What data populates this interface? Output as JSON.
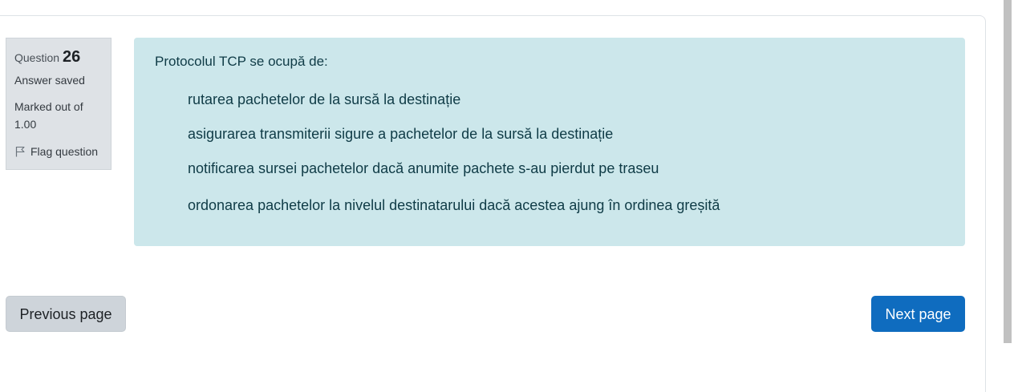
{
  "question_info": {
    "label": "Question",
    "number": "26",
    "state": "Answer saved",
    "grade": "Marked out of 1.00",
    "flag_label": "Flag question"
  },
  "question": {
    "text": "Protocolul TCP se ocupă de:",
    "answers": [
      "rutarea pachetelor de la sursă la destinație",
      "asigurarea transmiterii sigure a pachetelor de la sursă la destinație",
      "notificarea sursei pachetelor dacă anumite pachete s-au pierdut pe traseu",
      "ordonarea pachetelor la nivelul destinatarului dacă acestea ajung în ordinea greșită"
    ]
  },
  "navigation": {
    "previous_label": "Previous page",
    "next_label": "Next page"
  },
  "colors": {
    "content_background": "#cce7eb",
    "next_button": "#0f6cbf",
    "previous_button": "#ced4da",
    "info_background": "#dee2e6"
  }
}
